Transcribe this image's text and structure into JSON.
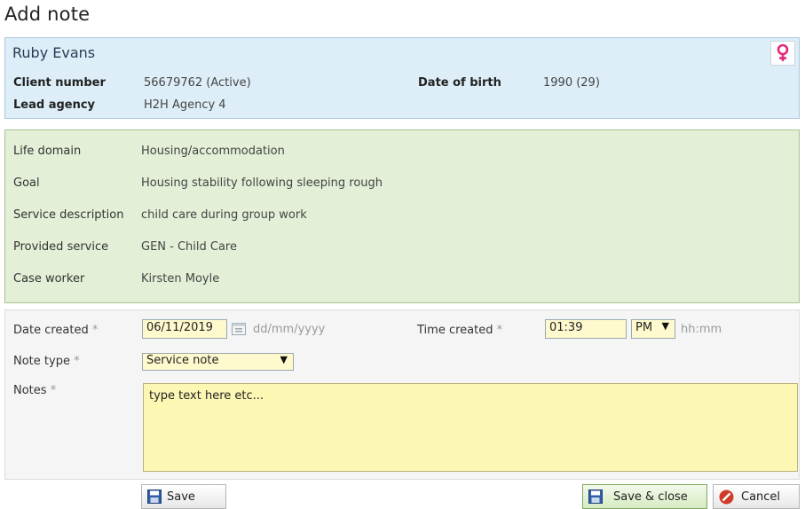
{
  "page": {
    "title": "Add note"
  },
  "client": {
    "name": "Ruby Evans",
    "client_number_label": "Client number",
    "client_number_value": "56679762 (Active)",
    "lead_agency_label": "Lead agency",
    "lead_agency_value": "H2H Agency 4",
    "dob_label": "Date of birth",
    "dob_value": "1990 (29)",
    "gender_icon": "female-icon"
  },
  "service": {
    "rows": [
      {
        "label": "Life domain",
        "value": "Housing/accommodation"
      },
      {
        "label": "Goal",
        "value": "Housing stability following sleeping rough"
      },
      {
        "label": "Service description",
        "value": "child care during group work"
      },
      {
        "label": "Provided service",
        "value": "GEN - Child Care"
      },
      {
        "label": "Case worker",
        "value": "Kirsten Moyle"
      }
    ]
  },
  "form": {
    "date_created_label": "Date created",
    "date_created_value": "06/11/2019",
    "date_hint": "dd/mm/yyyy",
    "time_created_label": "Time created",
    "time_created_value": "01:39",
    "ampm_value": "PM",
    "time_hint": "hh:mm",
    "note_type_label": "Note type",
    "note_type_value": "Service note",
    "notes_label": "Notes",
    "notes_value": "type text here etc...",
    "required_marker": "*"
  },
  "actions": {
    "save_label": "Save",
    "save_close_label": "Save & close",
    "cancel_label": "Cancel"
  },
  "colors": {
    "client_panel_bg": "#ddeef8",
    "service_panel_bg": "#e3efd6",
    "input_bg": "#fffacd",
    "female_icon": "#e02a7a",
    "cancel_icon": "#d23a2a",
    "save_icon": "#2f5fa8"
  }
}
